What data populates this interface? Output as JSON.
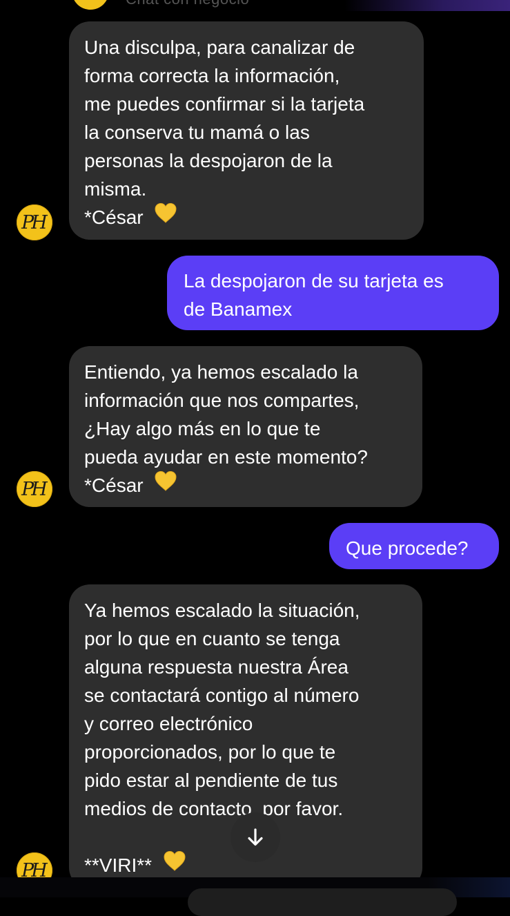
{
  "header": {
    "caption": "Chat con negocio"
  },
  "messages": [
    {
      "sender": "business",
      "lines": [
        "Una disculpa, para canalizar de",
        "forma correcta la información,",
        "me puedes confirmar si la tarjeta",
        "la conserva tu mamá o las",
        "personas la despojaron de la",
        "misma."
      ],
      "signature": "*César"
    },
    {
      "sender": "user",
      "lines": [
        "La despojaron de su tarjeta es",
        "de Banamex"
      ]
    },
    {
      "sender": "business",
      "lines": [
        "Entiendo, ya hemos escalado la",
        "información que nos compartes,",
        "¿Hay algo más en lo que te",
        "pueda ayudar en este momento?"
      ],
      "signature": "*César"
    },
    {
      "sender": "user",
      "lines": [
        "Que procede?"
      ]
    },
    {
      "sender": "business",
      "lines": [
        "Ya hemos escalado la situación,",
        "por lo que en cuanto se tenga",
        "alguna respuesta nuestra Área",
        "se contactará contigo al número",
        "y correo electrónico",
        "proporcionados, por lo que te",
        "pido estar al pendiente de tus",
        "medios de contacto, por favor."
      ],
      "signature": "**VIRI**"
    }
  ],
  "avatar": {
    "monogram": "PH",
    "color": "#f3c21a"
  },
  "icons": {
    "signature_emoji": "yellow-heart-icon",
    "scroll_down": "arrow-down-icon"
  },
  "colors": {
    "background": "#000000",
    "incoming_bubble": "#2e2e2e",
    "outgoing_bubble": "#5b3ef6",
    "text": "#ffffff",
    "heart": "#f6c431"
  }
}
